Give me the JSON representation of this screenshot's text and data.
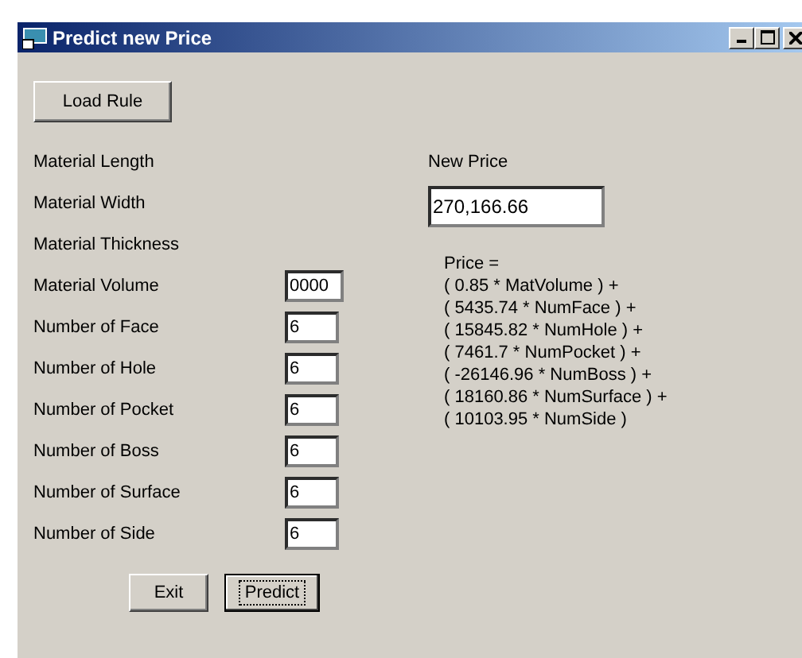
{
  "window": {
    "title": "Predict new Price"
  },
  "load_button": "Load Rule",
  "fields": [
    {
      "label": "Material Length"
    },
    {
      "label": "Material Width"
    },
    {
      "label": "Material Thickness"
    },
    {
      "label": "Material Volume",
      "value": "0000"
    },
    {
      "label": "Number of Face",
      "value": "6"
    },
    {
      "label": "Number of Hole",
      "value": "6"
    },
    {
      "label": "Number of Pocket",
      "value": "6"
    },
    {
      "label": "Number of Boss",
      "value": "6"
    },
    {
      "label": "Number of Surface",
      "value": "6"
    },
    {
      "label": "Number of Side",
      "value": "6"
    }
  ],
  "new_price": {
    "label": "New Price",
    "value": "270,166.66"
  },
  "formula": [
    "Price =",
    "( 0.85 * MatVolume ) +",
    "( 5435.74 * NumFace ) +",
    "( 15845.82 * NumHole ) +",
    "( 7461.7 * NumPocket ) +",
    "( -26146.96 * NumBoss ) +",
    "( 18160.86 * NumSurface ) +",
    "( 10103.95 * NumSide )"
  ],
  "buttons": [
    {
      "label": "Exit",
      "focused": false
    },
    {
      "label": "Predict",
      "focused": true
    }
  ]
}
